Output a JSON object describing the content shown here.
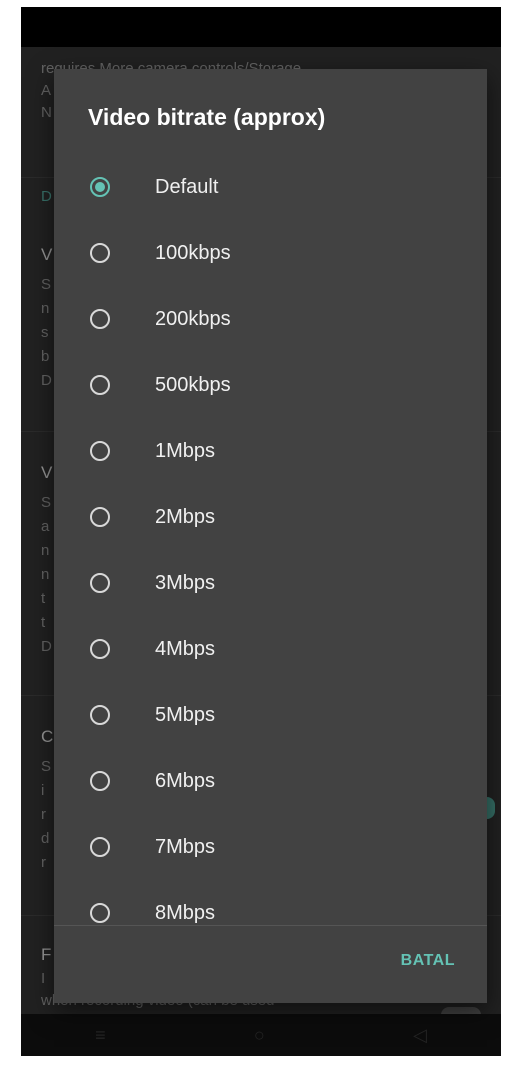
{
  "dialog": {
    "title": "Video bitrate (approx)",
    "selected_index": 0,
    "options": [
      {
        "label": "Default",
        "selected": true
      },
      {
        "label": "100kbps",
        "selected": false
      },
      {
        "label": "200kbps",
        "selected": false
      },
      {
        "label": "500kbps",
        "selected": false
      },
      {
        "label": "1Mbps",
        "selected": false
      },
      {
        "label": "2Mbps",
        "selected": false
      },
      {
        "label": "3Mbps",
        "selected": false
      },
      {
        "label": "4Mbps",
        "selected": false
      },
      {
        "label": "5Mbps",
        "selected": false
      },
      {
        "label": "6Mbps",
        "selected": false
      },
      {
        "label": "7Mbps",
        "selected": false
      },
      {
        "label": "8Mbps",
        "selected": false
      }
    ],
    "cancel_label": "BATAL"
  },
  "background": {
    "line_1": "requires More camera controls/Storage",
    "line_bottom": "when recording video (can be used"
  },
  "nav": {
    "recents_icon": "recents-icon",
    "home_icon": "home-icon",
    "back_icon": "back-icon"
  },
  "colors": {
    "accent": "#64c2b4",
    "dialog_bg": "#424242",
    "screen_bg": "#2f2f2f"
  }
}
